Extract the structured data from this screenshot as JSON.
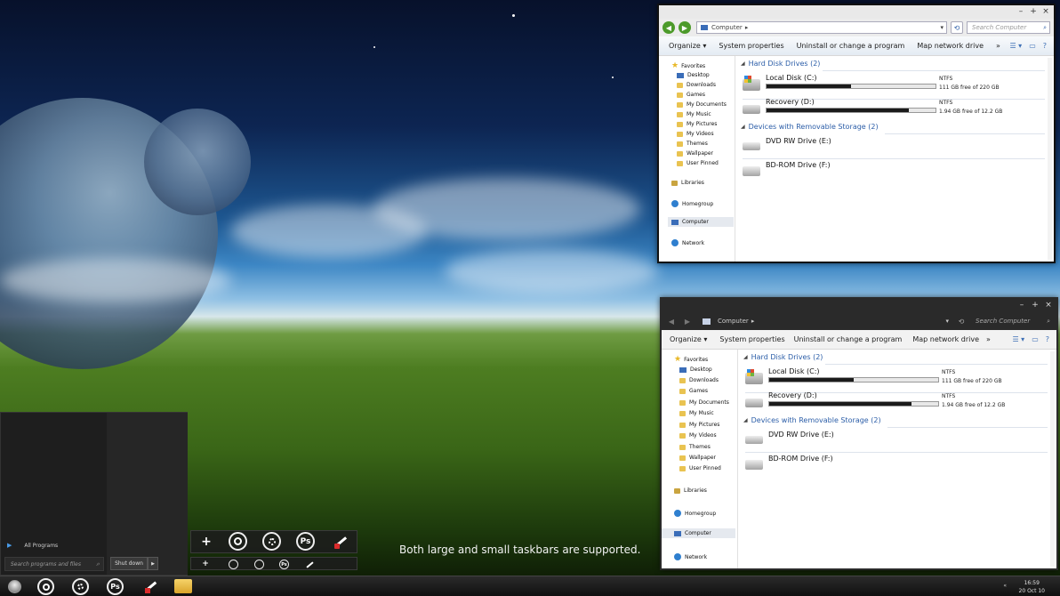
{
  "desktop": {
    "caption": "Both large and small taskbars are supported."
  },
  "explorer_top": {
    "address": "Computer",
    "search_placeholder": "Search Computer",
    "commands": [
      "Organize",
      "System properties",
      "Uninstall or change a program",
      "Map network drive"
    ],
    "more_symbol": "»",
    "nav": {
      "favorites": "Favorites",
      "favorite_items": [
        "Desktop",
        "Downloads",
        "Games",
        "My Documents",
        "My Music",
        "My Pictures",
        "My Videos",
        "Themes",
        "Wallpaper",
        "User Pinned"
      ],
      "libraries": "Libraries",
      "homegroup": "Homegroup",
      "computer": "Computer",
      "network": "Network"
    },
    "groups": {
      "hard_disks": "Hard Disk Drives (2)",
      "removable": "Devices with Removable Storage (2)"
    },
    "drives": [
      {
        "name": "Local Disk (C:)",
        "fs": "NTFS",
        "free": "111 GB free of 220 GB",
        "used_fraction": 0.5
      },
      {
        "name": "Recovery (D:)",
        "fs": "NTFS",
        "free": "1.94 GB free of 12.2 GB",
        "used_fraction": 0.84
      }
    ],
    "removable": [
      {
        "name": "DVD RW Drive (E:)"
      },
      {
        "name": "BD-ROM Drive (F:)"
      }
    ]
  },
  "explorer_bottom": {
    "address": "Computer",
    "search_placeholder": "Search Computer",
    "commands": [
      "Organize",
      "System properties",
      "Uninstall or change a program",
      "Map network drive"
    ],
    "more_symbol": "»",
    "nav": {
      "favorites": "Favorites",
      "favorite_items": [
        "Desktop",
        "Downloads",
        "Games",
        "My Documents",
        "My Music",
        "My Pictures",
        "My Videos",
        "Themes",
        "Wallpaper",
        "User Pinned"
      ],
      "libraries": "Libraries",
      "homegroup": "Homegroup",
      "computer": "Computer",
      "network": "Network"
    },
    "groups": {
      "hard_disks": "Hard Disk Drives (2)",
      "removable": "Devices with Removable Storage (2)"
    },
    "drives": [
      {
        "name": "Local Disk (C:)",
        "fs": "NTFS",
        "free": "111 GB free of 220 GB",
        "used_fraction": 0.5
      },
      {
        "name": "Recovery (D:)",
        "fs": "NTFS",
        "free": "1.94 GB free of 12.2 GB",
        "used_fraction": 0.84
      }
    ],
    "removable": [
      {
        "name": "DVD RW Drive (E:)"
      },
      {
        "name": "BD-ROM Drive (F:)"
      }
    ]
  },
  "start_menu": {
    "all_programs": "All Programs",
    "search_placeholder": "Search programs and files",
    "shutdown": "Shut down"
  },
  "dock_icons": [
    "plus-icon",
    "browser-icon",
    "chrome-icon",
    "photoshop-icon",
    "paint-icon"
  ],
  "dock_labels": {
    "plus": "+",
    "photoshop": "Ps"
  },
  "taskbar": {
    "time": "16:59",
    "date": "20 Oct 10",
    "icons": [
      "browser-icon",
      "chrome-icon",
      "photoshop-icon",
      "paint-icon",
      "folder-icon"
    ]
  },
  "colors": {
    "accent": "#2c5ea8",
    "taskbar": "#1a1a1a",
    "drive_bar": "#1b1b1b"
  }
}
